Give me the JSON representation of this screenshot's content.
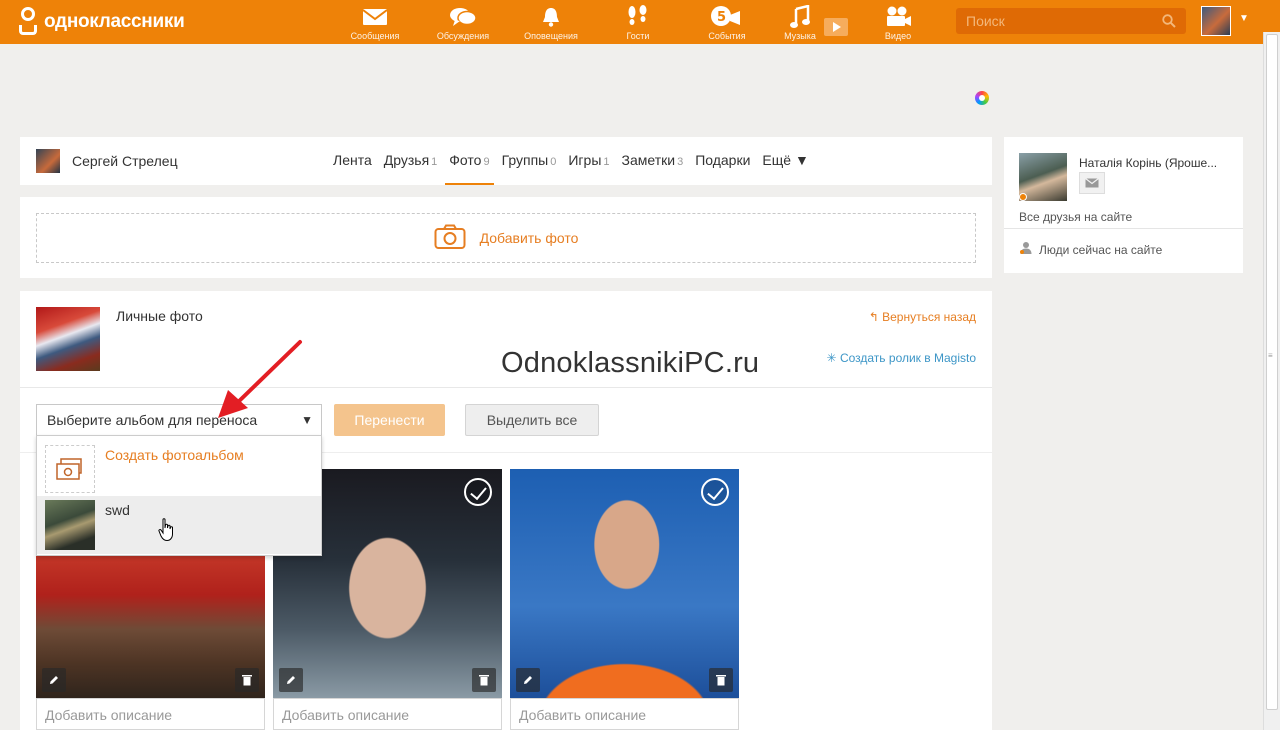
{
  "topbar": {
    "logo_text": "одноклассники",
    "nav": [
      {
        "label": "Сообщения",
        "icon": "envelope-icon"
      },
      {
        "label": "Обсуждения",
        "icon": "chat-bubbles-icon"
      },
      {
        "label": "Оповещения",
        "icon": "bell-icon"
      },
      {
        "label": "Гости",
        "icon": "footprints-icon"
      },
      {
        "label": "События",
        "icon": "events-icon"
      },
      {
        "label": "Музыка",
        "icon": "music-note-icon"
      },
      {
        "label": "Видео",
        "icon": "video-camera-icon"
      }
    ],
    "search_placeholder": "Поиск"
  },
  "profile": {
    "name": "Сергей Стрелец",
    "tabs": [
      {
        "label": "Лента",
        "count": ""
      },
      {
        "label": "Друзья",
        "count": "1"
      },
      {
        "label": "Фото",
        "count": "9",
        "active": true
      },
      {
        "label": "Группы",
        "count": "0"
      },
      {
        "label": "Игры",
        "count": "1"
      },
      {
        "label": "Заметки",
        "count": "3"
      },
      {
        "label": "Подарки",
        "count": ""
      },
      {
        "label": "Ещё ▼",
        "count": ""
      }
    ]
  },
  "add_photo": {
    "label": "Добавить фото"
  },
  "album": {
    "title": "Личные фото",
    "back_link": "Вернуться назад",
    "magisto_link": "Создать ролик в Magisto",
    "watermark": "OdnoklassnikiPC.ru",
    "select_placeholder": "Выберите альбом для переноса",
    "move_button": "Перенести",
    "select_all_button": "Выделить все",
    "dropdown": {
      "create_label": "Создать фотоальбом",
      "albums": [
        "swd"
      ]
    },
    "photos": [
      {
        "description_placeholder": "Добавить описание"
      },
      {
        "description_placeholder": "Добавить описание"
      },
      {
        "description_placeholder": "Добавить описание"
      }
    ]
  },
  "sidebar": {
    "friend_name": "Наталія Корінь (Ярошe...",
    "all_friends": "Все друзья на сайте",
    "people_online": "Люди сейчас на сайте"
  },
  "colors": {
    "brand": "#ee8208",
    "link_orange": "#e67e22",
    "link_blue": "#3d96c7"
  }
}
